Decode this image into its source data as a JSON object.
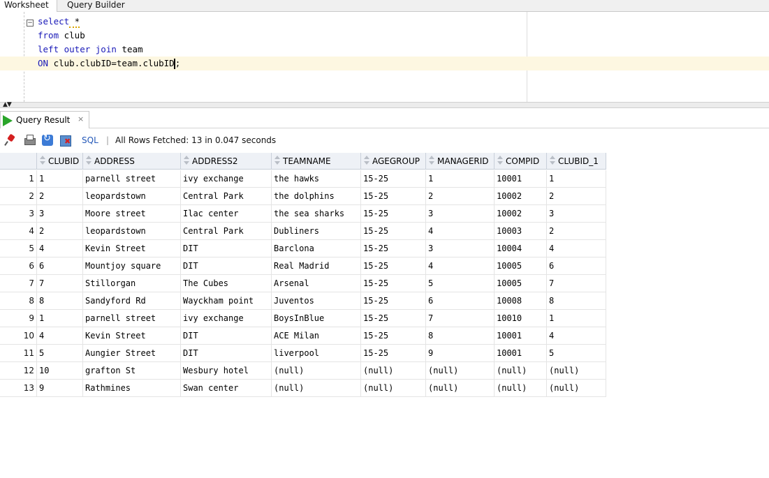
{
  "tabs": {
    "worksheet": "Worksheet",
    "query_builder": "Query Builder"
  },
  "editor": {
    "fold_symbol": "⊟",
    "lines": [
      {
        "kw": "select",
        "rest": " *"
      },
      {
        "kw": "from",
        "rest": " club"
      },
      {
        "kw": "left outer join",
        "rest": " team"
      },
      {
        "kw": "ON",
        "rest": " club.clubID=team.clubID"
      }
    ],
    "line4_tail": ";"
  },
  "splitter": {
    "arrows": "▲▼"
  },
  "result_tab": {
    "label": "Query Result",
    "close": "×"
  },
  "toolbar": {
    "sql_label": "SQL",
    "separator": "|",
    "status": "All Rows Fetched: 13 in 0.047 seconds"
  },
  "grid": {
    "columns": [
      "CLUBID",
      "ADDRESS",
      "ADDRESS2",
      "TEAMNAME",
      "AGEGROUP",
      "MANAGERID",
      "COMPID",
      "CLUBID_1"
    ],
    "rows": [
      [
        "1",
        "1",
        "parnell street",
        "ivy exchange",
        "the hawks",
        "15-25",
        "1",
        "10001",
        "1"
      ],
      [
        "2",
        "2",
        "leopardstown",
        "Central Park",
        "the dolphins",
        "15-25",
        "2",
        "10002",
        "2"
      ],
      [
        "3",
        "3",
        "Moore street",
        "Ilac center",
        "the sea sharks",
        "15-25",
        "3",
        "10002",
        "3"
      ],
      [
        "4",
        "2",
        "leopardstown",
        "Central Park",
        "Dubliners",
        "15-25",
        "4",
        "10003",
        "2"
      ],
      [
        "5",
        "4",
        "Kevin Street",
        "DIT",
        "Barclona",
        "15-25",
        "3",
        "10004",
        "4"
      ],
      [
        "6",
        "6",
        "Mountjoy square",
        "DIT",
        "Real Madrid",
        "15-25",
        "4",
        "10005",
        "6"
      ],
      [
        "7",
        "7",
        "Stillorgan",
        "The Cubes",
        "Arsenal",
        "15-25",
        "5",
        "10005",
        "7"
      ],
      [
        "8",
        "8",
        "Sandyford Rd",
        "Wayckham point",
        "Juventos",
        "15-25",
        "6",
        "10008",
        "8"
      ],
      [
        "9",
        "1",
        "parnell street",
        "ivy exchange",
        "BoysInBlue",
        "15-25",
        "7",
        "10010",
        "1"
      ],
      [
        "10",
        "4",
        "Kevin Street",
        "DIT",
        "ACE Milan",
        "15-25",
        "8",
        "10001",
        "4"
      ],
      [
        "11",
        "5",
        "Aungier Street",
        "DIT",
        "liverpool",
        "15-25",
        "9",
        "10001",
        "5"
      ],
      [
        "12",
        "10",
        "grafton St",
        "Wesbury hotel",
        "(null)",
        "(null)",
        "(null)",
        "(null)",
        "(null)"
      ],
      [
        "13",
        "9",
        "Rathmines",
        "Swan center",
        "(null)",
        "(null)",
        "(null)",
        "(null)",
        "(null)"
      ]
    ]
  },
  "colors": {
    "keyword": "#1a1ab8",
    "current_line": "#fdf7e1",
    "run_green": "#2aa52a",
    "sql_link": "#2458b8"
  }
}
